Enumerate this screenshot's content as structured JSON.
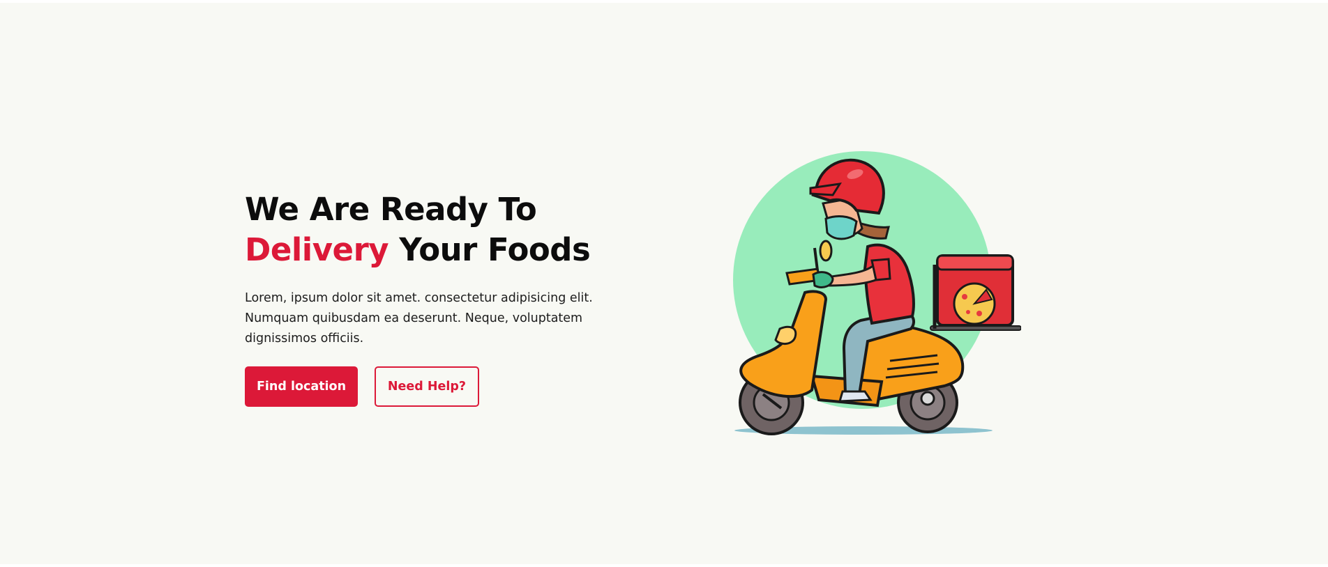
{
  "hero": {
    "headline_line1": "We Are Ready To",
    "headline_accent": "Delivery",
    "headline_rest": " Your Foods",
    "description": "Lorem, ipsum dolor sit amet. consectetur adipisicing elit. Numquam quibusdam ea deserunt. Neque, voluptatem dignissimos officiis.",
    "primary_button_label": "Find location",
    "secondary_button_label": "Need Help?"
  },
  "colors": {
    "accent": "#dc1938",
    "background": "#f8f9f4",
    "heading": "#0c0c0c",
    "illustration_circle": "#98ecbb",
    "scooter_body": "#f9a01a",
    "rider_shirt": "#e8313b",
    "helmet": "#e52b35",
    "delivery_box": "#e02f37",
    "pizza": "#f6c94f"
  },
  "illustration": {
    "icon": "delivery-rider-illustration"
  }
}
